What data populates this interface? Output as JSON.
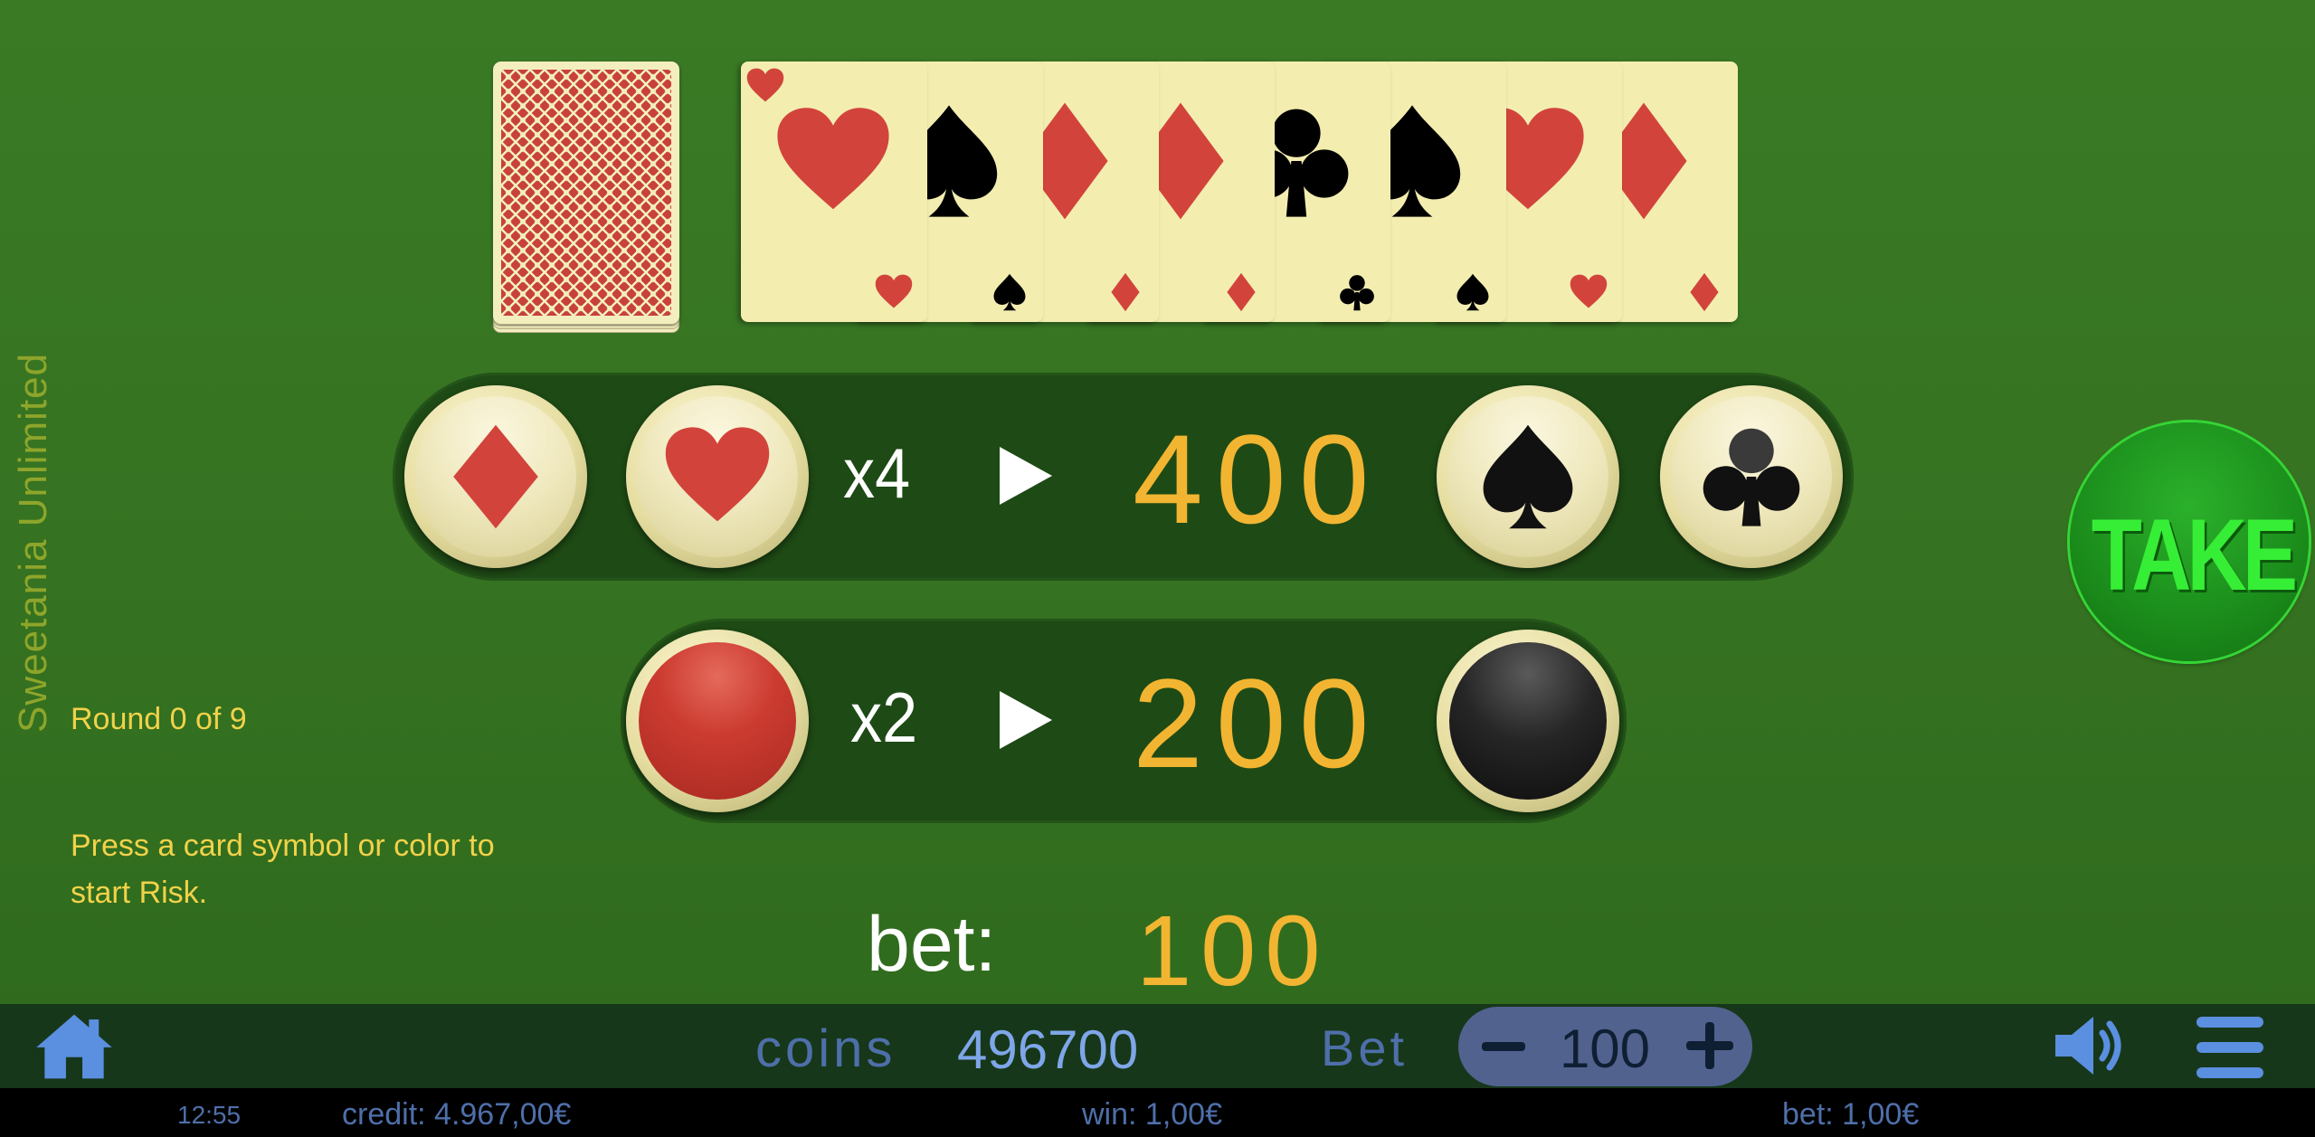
{
  "brand": {
    "vertical_label": "Sweetania Unlimited",
    "color": "#8ea52b"
  },
  "history_cards": [
    {
      "suit": "hearts",
      "color": "#d2443b"
    },
    {
      "suit": "spades",
      "color": "#000000"
    },
    {
      "suit": "diamonds",
      "color": "#d2443b"
    },
    {
      "suit": "diamonds",
      "color": "#d2443b"
    },
    {
      "suit": "clubs",
      "color": "#000000"
    },
    {
      "suit": "spades",
      "color": "#000000"
    },
    {
      "suit": "hearts",
      "color": "#d2443b"
    },
    {
      "suit": "diamonds",
      "color": "#d2443b"
    }
  ],
  "deck": {
    "icon": "card-back-deck"
  },
  "suit_row": {
    "multiplier": "x4",
    "amount": "400",
    "buttons": [
      "diamonds",
      "hearts",
      "spades",
      "clubs"
    ]
  },
  "color_row": {
    "multiplier": "x2",
    "amount": "200",
    "buttons": [
      "red",
      "black"
    ]
  },
  "take_button": {
    "label": "TAKE"
  },
  "round_info": "Round 0  of 9",
  "instruction": {
    "line1": "Press a card symbol or color to",
    "line2": "start Risk."
  },
  "bet_display": {
    "label": "bet:",
    "value": "100"
  },
  "toolbar": {
    "home_icon": "home-icon",
    "coins_label": "coins",
    "coins_value": "496700",
    "bet_label": "Bet",
    "bet_value": "100",
    "minus_icon": "minus-icon",
    "plus_icon": "plus-icon",
    "sound_icon": "speaker-icon",
    "menu_icon": "hamburger-menu-icon"
  },
  "status_bar": {
    "time": "12:55",
    "credit": "credit: 4.967,00€",
    "win": "win: 1,00€",
    "bet": "bet: 1,00€"
  },
  "colors": {
    "accent_gold": "#f2b531",
    "table_green": "#357221",
    "take_green": "#36ee36"
  }
}
